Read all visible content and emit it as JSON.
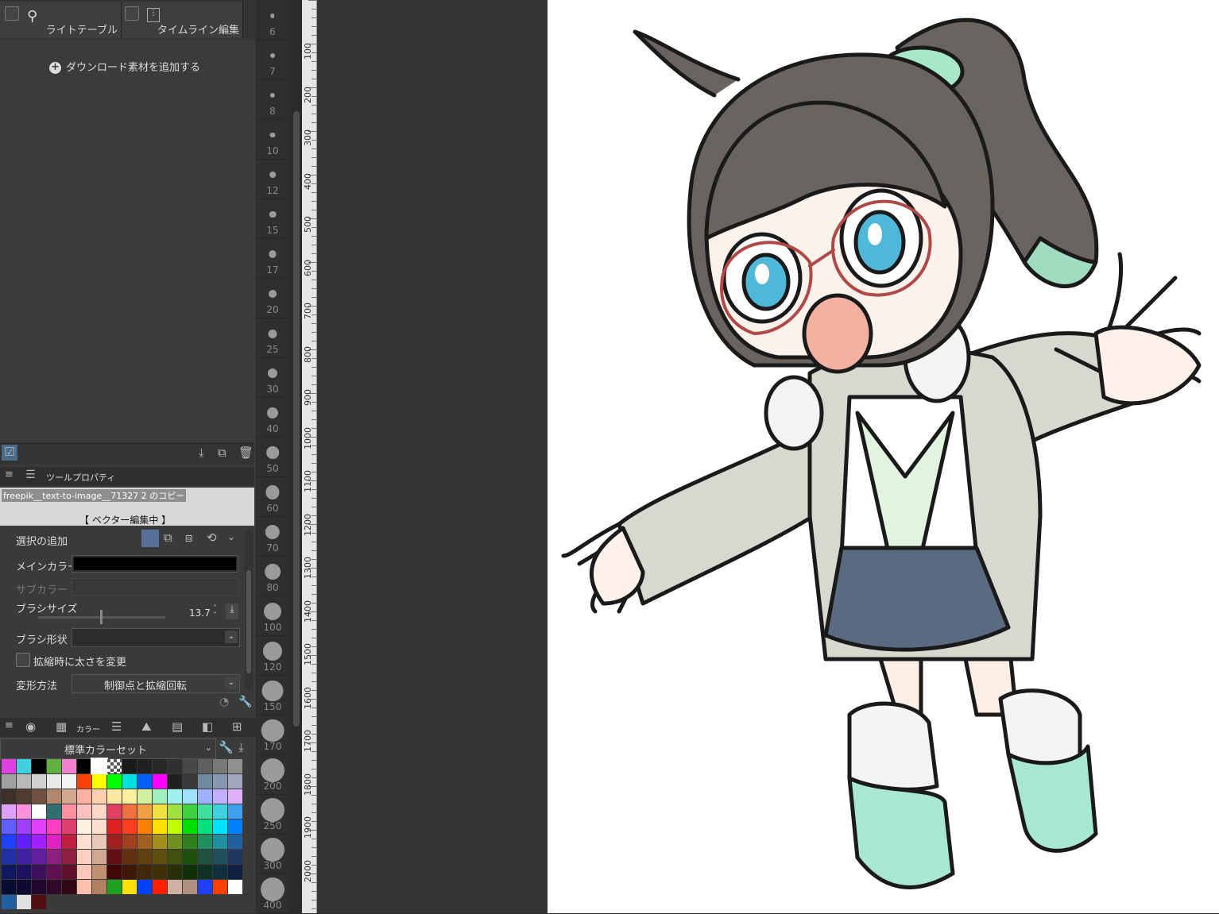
{
  "tabs": {
    "light_table": "ライトテーブル",
    "timeline_edit": "タイムライン編集"
  },
  "material": {
    "add_download": "ダウンロード素材を追加する"
  },
  "tool_property": {
    "title": "ツールプロパティ",
    "file_name": "freepik__text-to-image__71327 2 のコピー",
    "status": "【 ベクター編集中 】",
    "selection_add": "選択の追加",
    "main_color_label": "メインカラー",
    "sub_color_label": "サブカラー",
    "brush_size_label": "ブラシサイズ",
    "brush_size_value": "13.7",
    "brush_shape_label": "ブラシ形状",
    "scale_thickness_label": "拡縮時に太さを変更",
    "transform_label": "変形方法",
    "transform_value": "制御点と拡縮回転",
    "main_color": "#000000"
  },
  "color_panel": {
    "tab_label": "カラー",
    "color_set": "標準カラーセット",
    "swatch_rows": [
      [
        "#e040e0",
        "#40d0e0",
        "#000000",
        "#60b040",
        "#f080d0",
        "#000000",
        "#ffffff",
        "checker",
        "#1a1a1a",
        "#202020",
        "#282828",
        "#303030",
        "#484848",
        "#606060",
        "#787878",
        "#909090"
      ],
      [
        "#a0a0a0",
        "#b8b8b8",
        "#d0d0d0",
        "#e8e8e8",
        "#f4f4f4",
        "#ff4000",
        "#ffff00",
        "#00ff00",
        "#00e0e0",
        "#0060ff",
        "#ff00ff",
        "#202020",
        "#3a3a3a",
        "#7088a0",
        "#8898b0",
        "#a0a8c0"
      ],
      [
        "#3c3028",
        "#503c30",
        "#705040",
        "#b08870",
        "#d0a890",
        "#ffb0a0",
        "#ffd0b0",
        "#ffe8a0",
        "#fff0a0",
        "#d0f0a0",
        "#a0f0c0",
        "#a0f0f0",
        "#a0e0ff",
        "#a0b0ff",
        "#c0b0ff",
        "#e0b0ff"
      ],
      [
        "#e0a0ff",
        "#ff90e0",
        "#ffffff",
        "#307070",
        "#ff90a0",
        "#ffc0c0",
        "#ffd8c8",
        "#e04060",
        "#f07040",
        "#f0a040",
        "#f0e040",
        "#a0e040",
        "#40d040",
        "#40e0a0",
        "#40d0e0",
        "#40a0f0"
      ],
      [
        "#6060ff",
        "#a040ff",
        "#e040ff",
        "#ff40c0",
        "#e04070",
        "#fff0e0",
        "#ffe0d0",
        "#e02020",
        "#ff4020",
        "#ff8000",
        "#ffe000",
        "#c0ff00",
        "#00e000",
        "#00e080",
        "#00e0ff",
        "#0080ff"
      ],
      [
        "#2040ff",
        "#6020ff",
        "#a020ff",
        "#e020c0",
        "#c02040",
        "#ffe0d0",
        "#e8c8b8",
        "#a02020",
        "#a04020",
        "#a06020",
        "#a09020",
        "#709020",
        "#308020",
        "#209060",
        "#2090a0",
        "#2060a0"
      ],
      [
        "#2030a0",
        "#4020a0",
        "#6020a0",
        "#902080",
        "#902040",
        "#ffd0c0",
        "#d0a890",
        "#601010",
        "#603010",
        "#604010",
        "#605010",
        "#405010",
        "#205010",
        "#205040",
        "#205060",
        "#203860"
      ],
      [
        "#101860",
        "#201060",
        "#401060",
        "#601050",
        "#601028",
        "#ffc8b8",
        "#c09070",
        "#400808",
        "#401808",
        "#402808",
        "#403008",
        "#283008",
        "#103008",
        "#103028",
        "#103040",
        "#102040"
      ],
      [
        "#080c30",
        "#100830",
        "#200830",
        "#300828",
        "#300814",
        "#ffc0b0",
        "#b08060",
        "#20a020",
        "#ffe000",
        "#0040ff",
        "#ff2000",
        "#d0b0a0",
        "#b09080",
        "#2040ff",
        "#ff4000",
        "#ffffff"
      ],
      [
        "#2060a0",
        "#e0e0e0",
        "#501010"
      ]
    ]
  },
  "brush_sizes": [
    "6",
    "7",
    "8",
    "10",
    "12",
    "15",
    "17",
    "20",
    "25",
    "30",
    "40",
    "50",
    "60",
    "70",
    "80",
    "100",
    "120",
    "150",
    "170",
    "200",
    "250",
    "300",
    "400"
  ],
  "ruler_labels": [
    "100",
    "200",
    "300",
    "400",
    "500",
    "600",
    "700",
    "800",
    "900",
    "1000",
    "1100",
    "1200",
    "1300",
    "1400",
    "1500",
    "1600",
    "1700",
    "1800",
    "1900",
    "2000"
  ]
}
